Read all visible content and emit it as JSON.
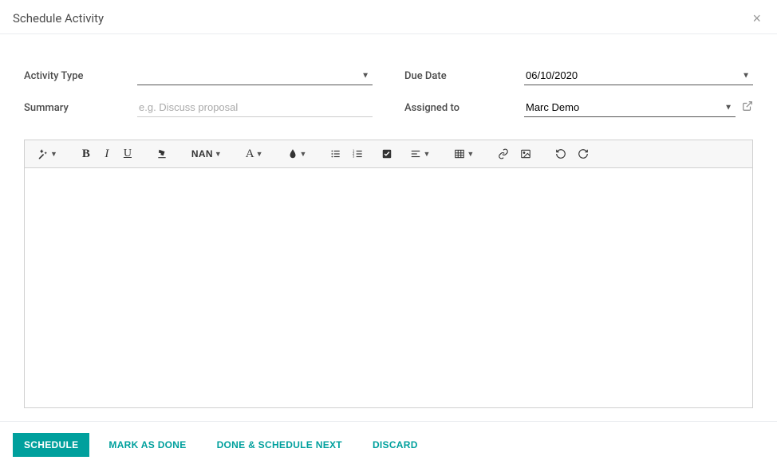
{
  "header": {
    "title": "Schedule Activity"
  },
  "form": {
    "activity_type": {
      "label": "Activity Type",
      "value": ""
    },
    "due_date": {
      "label": "Due Date",
      "value": "06/10/2020"
    },
    "summary": {
      "label": "Summary",
      "placeholder": "e.g. Discuss proposal",
      "value": ""
    },
    "assigned_to": {
      "label": "Assigned to",
      "value": "Marc Demo"
    }
  },
  "toolbar": {
    "font_size_label": "NAN",
    "font_family_label": "A"
  },
  "footer": {
    "schedule": "Schedule",
    "mark_as_done": "Mark as Done",
    "done_schedule_next": "Done & Schedule Next",
    "discard": "Discard"
  }
}
